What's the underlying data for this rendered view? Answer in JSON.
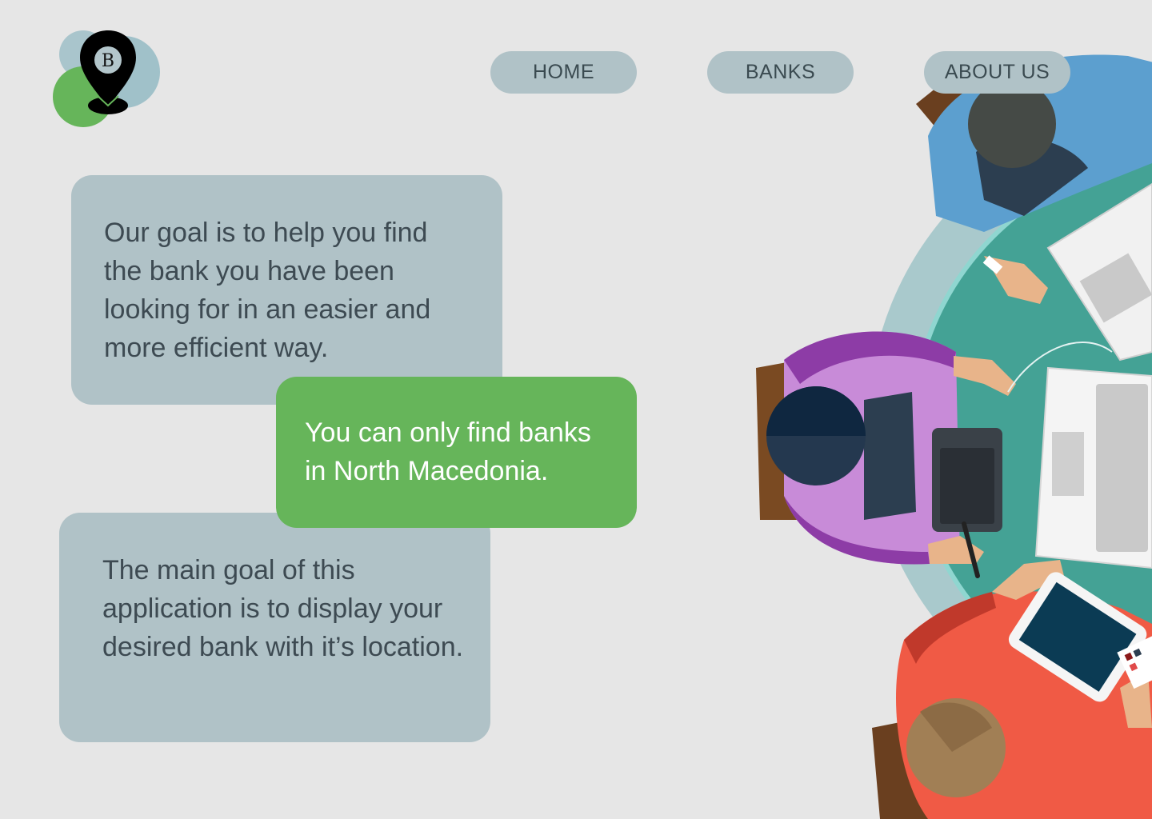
{
  "logo": {
    "letter": "B",
    "colors": {
      "green": "#66b55a",
      "blue": "#a7c4cb",
      "pin": "#000000"
    }
  },
  "nav": {
    "home_label": "HOME",
    "banks_label": "BANKS",
    "about_label": "ABOUT US"
  },
  "cards": {
    "goal_text": "Our goal is to help you find the bank you have been looking for in an easier and more efficient way.",
    "limit_text": "You can only find banks in North Macedonia.",
    "main_text": "The main goal of this application is to display your desired bank with it’s location."
  },
  "colors": {
    "background": "#e6e6e6",
    "card_gray": "#b0c2c7",
    "accent_green": "#66b55a"
  },
  "illustration": {
    "icon": "team-meeting-illustration"
  }
}
